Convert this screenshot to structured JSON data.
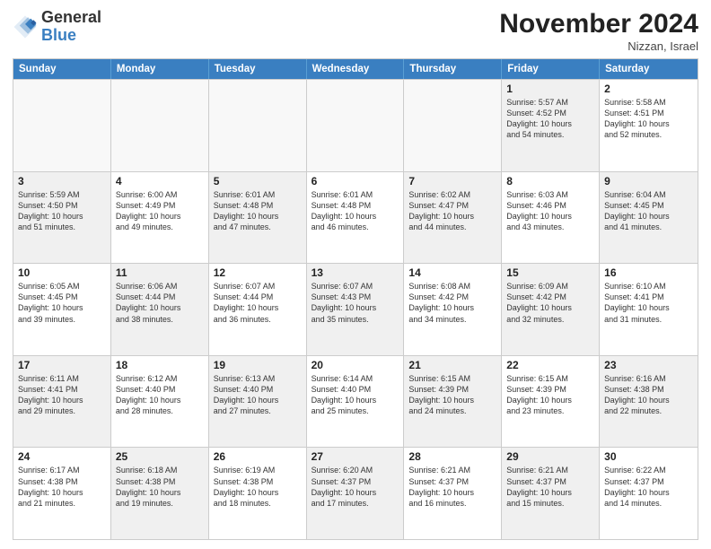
{
  "header": {
    "logo_line1": "General",
    "logo_line2": "Blue",
    "month_title": "November 2024",
    "subtitle": "Nizzan, Israel"
  },
  "weekdays": [
    "Sunday",
    "Monday",
    "Tuesday",
    "Wednesday",
    "Thursday",
    "Friday",
    "Saturday"
  ],
  "rows": [
    [
      {
        "day": "",
        "info": "",
        "shaded": false,
        "empty": true
      },
      {
        "day": "",
        "info": "",
        "shaded": false,
        "empty": true
      },
      {
        "day": "",
        "info": "",
        "shaded": false,
        "empty": true
      },
      {
        "day": "",
        "info": "",
        "shaded": false,
        "empty": true
      },
      {
        "day": "",
        "info": "",
        "shaded": false,
        "empty": true
      },
      {
        "day": "1",
        "info": "Sunrise: 5:57 AM\nSunset: 4:52 PM\nDaylight: 10 hours\nand 54 minutes.",
        "shaded": true
      },
      {
        "day": "2",
        "info": "Sunrise: 5:58 AM\nSunset: 4:51 PM\nDaylight: 10 hours\nand 52 minutes.",
        "shaded": false
      }
    ],
    [
      {
        "day": "3",
        "info": "Sunrise: 5:59 AM\nSunset: 4:50 PM\nDaylight: 10 hours\nand 51 minutes.",
        "shaded": true
      },
      {
        "day": "4",
        "info": "Sunrise: 6:00 AM\nSunset: 4:49 PM\nDaylight: 10 hours\nand 49 minutes.",
        "shaded": false
      },
      {
        "day": "5",
        "info": "Sunrise: 6:01 AM\nSunset: 4:48 PM\nDaylight: 10 hours\nand 47 minutes.",
        "shaded": true
      },
      {
        "day": "6",
        "info": "Sunrise: 6:01 AM\nSunset: 4:48 PM\nDaylight: 10 hours\nand 46 minutes.",
        "shaded": false
      },
      {
        "day": "7",
        "info": "Sunrise: 6:02 AM\nSunset: 4:47 PM\nDaylight: 10 hours\nand 44 minutes.",
        "shaded": true
      },
      {
        "day": "8",
        "info": "Sunrise: 6:03 AM\nSunset: 4:46 PM\nDaylight: 10 hours\nand 43 minutes.",
        "shaded": false
      },
      {
        "day": "9",
        "info": "Sunrise: 6:04 AM\nSunset: 4:45 PM\nDaylight: 10 hours\nand 41 minutes.",
        "shaded": true
      }
    ],
    [
      {
        "day": "10",
        "info": "Sunrise: 6:05 AM\nSunset: 4:45 PM\nDaylight: 10 hours\nand 39 minutes.",
        "shaded": false
      },
      {
        "day": "11",
        "info": "Sunrise: 6:06 AM\nSunset: 4:44 PM\nDaylight: 10 hours\nand 38 minutes.",
        "shaded": true
      },
      {
        "day": "12",
        "info": "Sunrise: 6:07 AM\nSunset: 4:44 PM\nDaylight: 10 hours\nand 36 minutes.",
        "shaded": false
      },
      {
        "day": "13",
        "info": "Sunrise: 6:07 AM\nSunset: 4:43 PM\nDaylight: 10 hours\nand 35 minutes.",
        "shaded": true
      },
      {
        "day": "14",
        "info": "Sunrise: 6:08 AM\nSunset: 4:42 PM\nDaylight: 10 hours\nand 34 minutes.",
        "shaded": false
      },
      {
        "day": "15",
        "info": "Sunrise: 6:09 AM\nSunset: 4:42 PM\nDaylight: 10 hours\nand 32 minutes.",
        "shaded": true
      },
      {
        "day": "16",
        "info": "Sunrise: 6:10 AM\nSunset: 4:41 PM\nDaylight: 10 hours\nand 31 minutes.",
        "shaded": false
      }
    ],
    [
      {
        "day": "17",
        "info": "Sunrise: 6:11 AM\nSunset: 4:41 PM\nDaylight: 10 hours\nand 29 minutes.",
        "shaded": true
      },
      {
        "day": "18",
        "info": "Sunrise: 6:12 AM\nSunset: 4:40 PM\nDaylight: 10 hours\nand 28 minutes.",
        "shaded": false
      },
      {
        "day": "19",
        "info": "Sunrise: 6:13 AM\nSunset: 4:40 PM\nDaylight: 10 hours\nand 27 minutes.",
        "shaded": true
      },
      {
        "day": "20",
        "info": "Sunrise: 6:14 AM\nSunset: 4:40 PM\nDaylight: 10 hours\nand 25 minutes.",
        "shaded": false
      },
      {
        "day": "21",
        "info": "Sunrise: 6:15 AM\nSunset: 4:39 PM\nDaylight: 10 hours\nand 24 minutes.",
        "shaded": true
      },
      {
        "day": "22",
        "info": "Sunrise: 6:15 AM\nSunset: 4:39 PM\nDaylight: 10 hours\nand 23 minutes.",
        "shaded": false
      },
      {
        "day": "23",
        "info": "Sunrise: 6:16 AM\nSunset: 4:38 PM\nDaylight: 10 hours\nand 22 minutes.",
        "shaded": true
      }
    ],
    [
      {
        "day": "24",
        "info": "Sunrise: 6:17 AM\nSunset: 4:38 PM\nDaylight: 10 hours\nand 21 minutes.",
        "shaded": false
      },
      {
        "day": "25",
        "info": "Sunrise: 6:18 AM\nSunset: 4:38 PM\nDaylight: 10 hours\nand 19 minutes.",
        "shaded": true
      },
      {
        "day": "26",
        "info": "Sunrise: 6:19 AM\nSunset: 4:38 PM\nDaylight: 10 hours\nand 18 minutes.",
        "shaded": false
      },
      {
        "day": "27",
        "info": "Sunrise: 6:20 AM\nSunset: 4:37 PM\nDaylight: 10 hours\nand 17 minutes.",
        "shaded": true
      },
      {
        "day": "28",
        "info": "Sunrise: 6:21 AM\nSunset: 4:37 PM\nDaylight: 10 hours\nand 16 minutes.",
        "shaded": false
      },
      {
        "day": "29",
        "info": "Sunrise: 6:21 AM\nSunset: 4:37 PM\nDaylight: 10 hours\nand 15 minutes.",
        "shaded": true
      },
      {
        "day": "30",
        "info": "Sunrise: 6:22 AM\nSunset: 4:37 PM\nDaylight: 10 hours\nand 14 minutes.",
        "shaded": false
      }
    ]
  ]
}
